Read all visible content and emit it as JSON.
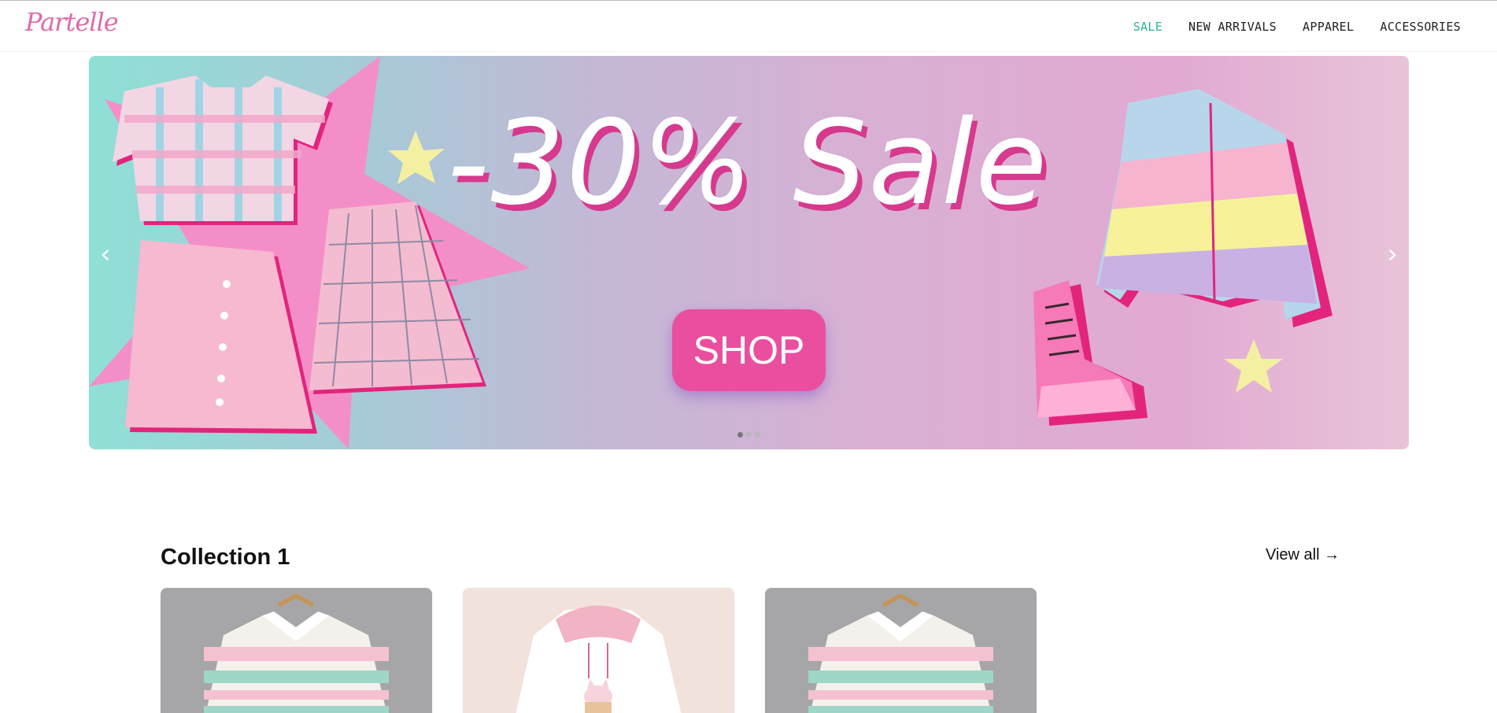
{
  "brand": {
    "logo": "Partelle"
  },
  "nav": {
    "items": [
      {
        "label": "SALE",
        "active": true
      },
      {
        "label": "NEW ARRIVALS",
        "active": false
      },
      {
        "label": "APPAREL",
        "active": false
      },
      {
        "label": "ACCESSORIES",
        "active": false
      }
    ]
  },
  "hero": {
    "headline": "-30% Sale",
    "cta": "SHOP",
    "prev_glyph": "‹",
    "next_glyph": "›",
    "slides_count": 3,
    "active_slide": 1
  },
  "collection": {
    "title": "Collection 1",
    "view_all": "View all →",
    "products": [
      {
        "name": "striped-polo-sweater-icon"
      },
      {
        "name": "cat-hoodie-icon"
      },
      {
        "name": "striped-polo-sweater-icon"
      }
    ]
  },
  "colors": {
    "accent": "#2fb39a",
    "brand_pink": "#e06aa8",
    "cta_pink": "#ea4f9f"
  }
}
